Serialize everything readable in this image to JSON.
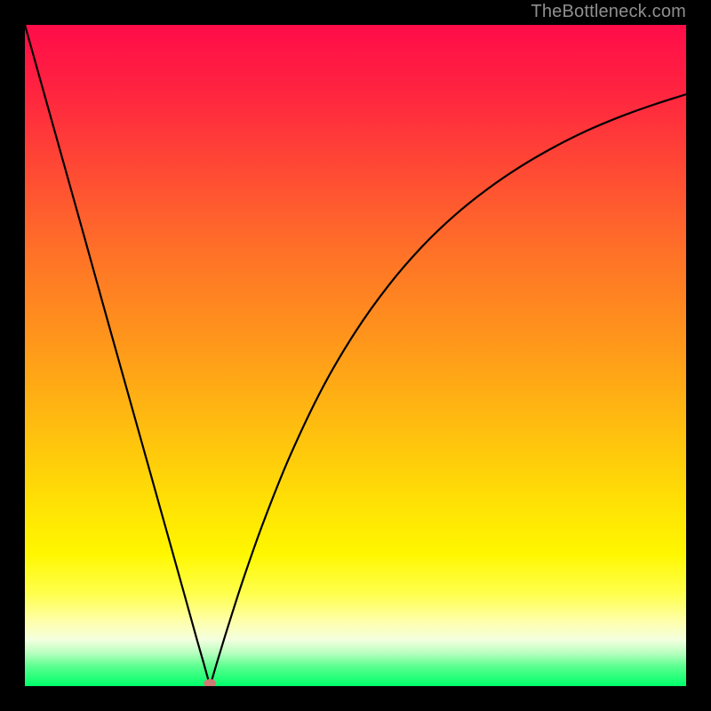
{
  "attribution": "TheBottleneck.com",
  "colors": {
    "frame": "#000000",
    "attribution_text": "#8f8f8f",
    "curve": "#000000",
    "marker_fill": "#cf7a72",
    "gradient_stops": [
      {
        "offset": 0.0,
        "color": "#ff0c49"
      },
      {
        "offset": 0.1,
        "color": "#ff2440"
      },
      {
        "offset": 0.22,
        "color": "#ff4a34"
      },
      {
        "offset": 0.35,
        "color": "#ff7327"
      },
      {
        "offset": 0.48,
        "color": "#ff971b"
      },
      {
        "offset": 0.6,
        "color": "#ffbb10"
      },
      {
        "offset": 0.72,
        "color": "#ffe005"
      },
      {
        "offset": 0.8,
        "color": "#fff700"
      },
      {
        "offset": 0.86,
        "color": "#ffff4d"
      },
      {
        "offset": 0.9,
        "color": "#ffffa7"
      },
      {
        "offset": 0.93,
        "color": "#f3ffdf"
      },
      {
        "offset": 0.95,
        "color": "#b8ffbf"
      },
      {
        "offset": 0.97,
        "color": "#5cff90"
      },
      {
        "offset": 1.0,
        "color": "#00ff69"
      }
    ]
  },
  "chart_data": {
    "type": "line",
    "title": "",
    "xlabel": "",
    "ylabel": "",
    "xlim": [
      0,
      100
    ],
    "ylim": [
      0,
      100
    ],
    "grid": false,
    "legend": false,
    "min_marker": {
      "x": 28,
      "y": 0
    },
    "series": [
      {
        "name": "curve",
        "x": [
          0,
          3,
          6,
          9,
          12,
          15,
          18,
          21,
          24,
          26,
          27,
          28,
          29,
          30,
          31,
          33,
          36,
          40,
          45,
          50,
          55,
          60,
          65,
          70,
          75,
          80,
          85,
          90,
          95,
          100
        ],
        "y": [
          100,
          89.3,
          78.6,
          67.9,
          57.1,
          46.4,
          35.7,
          25.0,
          14.3,
          7.1,
          3.6,
          0.0,
          3.4,
          6.7,
          9.9,
          16.1,
          24.6,
          34.6,
          45.1,
          53.6,
          60.6,
          66.4,
          71.2,
          75.2,
          78.6,
          81.5,
          84.0,
          86.1,
          87.9,
          89.5
        ]
      }
    ]
  }
}
